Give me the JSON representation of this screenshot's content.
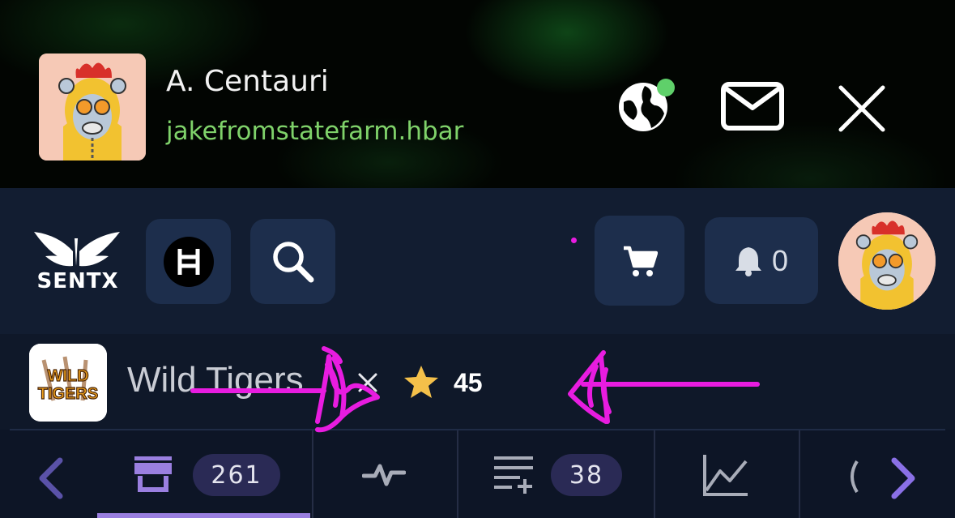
{
  "profile": {
    "name": "A. Centauri",
    "handle": "jakefromstatefarm.hbar"
  },
  "header_icons": [
    "globe-icon",
    "mail-icon",
    "close-icon"
  ],
  "nav": {
    "brand": "SENTX",
    "notifications_count": "0"
  },
  "collection": {
    "name": "Wild Tigers",
    "logo_text_line1": "WILD",
    "logo_text_line2": "TIGERS",
    "rating": "45"
  },
  "tabs": {
    "listings_count": "261",
    "lists_count": "38"
  },
  "colors": {
    "accent": "#9a7fe0",
    "handle_green": "#7fd26a",
    "status_green": "#5fd06a",
    "star": "#f4c04a",
    "annotation_magenta": "#e81ce0"
  }
}
